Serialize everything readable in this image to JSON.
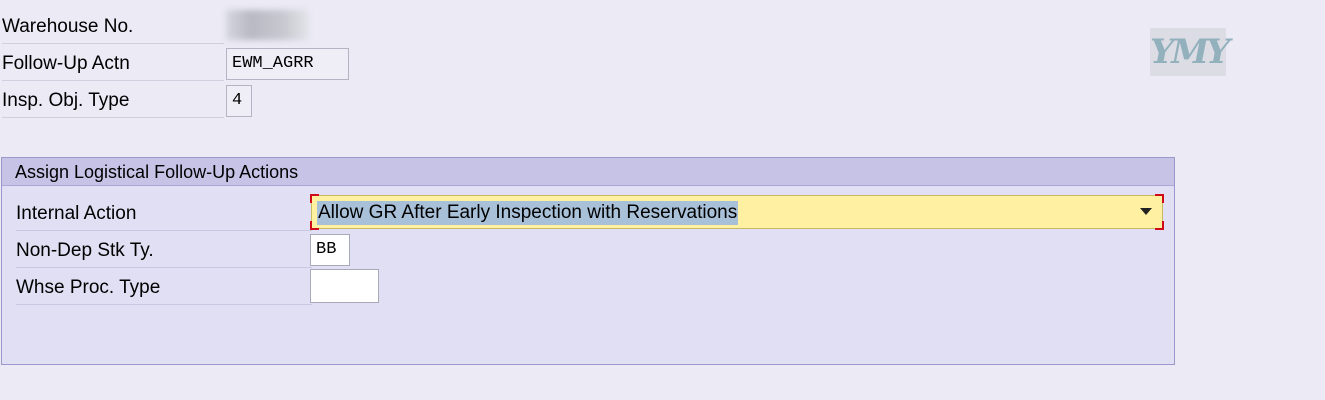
{
  "header_fields": {
    "warehouse_no": {
      "label": "Warehouse No.",
      "value": ""
    },
    "follow_up_actn": {
      "label": "Follow-Up Actn",
      "value": "EWM_AGRR"
    },
    "insp_obj_type": {
      "label": "Insp. Obj. Type",
      "value": "4"
    }
  },
  "logo_text": "YMY",
  "group": {
    "title": "Assign Logistical Follow-Up Actions",
    "internal_action": {
      "label": "Internal Action",
      "value": "Allow GR After Early Inspection with Reservations"
    },
    "non_dep_stk_ty": {
      "label": "Non-Dep Stk Ty.",
      "value": "BB"
    },
    "whse_proc_type": {
      "label": "Whse Proc. Type",
      "value": ""
    }
  },
  "colors": {
    "background": "#ebeaf5",
    "group_header": "#c6c3e6",
    "dropdown_bg": "#fff1a1",
    "selection": "#a8c0d8",
    "focus_corners": "#d10a1a"
  }
}
